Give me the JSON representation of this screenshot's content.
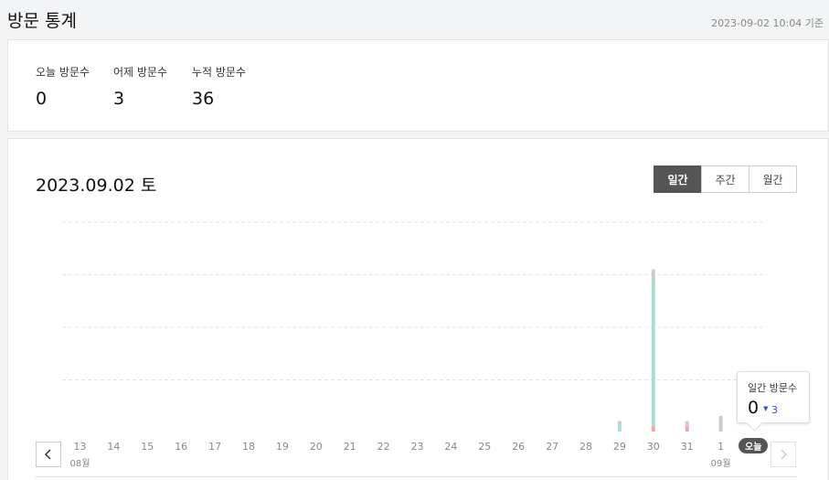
{
  "header": {
    "title": "방문 통계",
    "timestamp": "2023-09-02 10:04 기준"
  },
  "stats": [
    {
      "label": "오늘 방문수",
      "value": "0"
    },
    {
      "label": "어제 방문수",
      "value": "3"
    },
    {
      "label": "누적 방문수",
      "value": "36"
    }
  ],
  "chart_section": {
    "date_title": "2023.09.02 토",
    "period_tabs": [
      {
        "label": "일간",
        "active": true
      },
      {
        "label": "주간",
        "active": false
      },
      {
        "label": "월간",
        "active": false
      }
    ],
    "today_badge": "오늘",
    "prev_icon": "chevron-left-icon",
    "next_icon": "chevron-right-icon"
  },
  "tooltip": {
    "label": "일간 방문수",
    "value": "0",
    "diff": "3",
    "diff_icon": "triangle-down-icon",
    "diff_color": "#2f55c8"
  },
  "chart_data": {
    "type": "bar",
    "categories": [
      "13",
      "14",
      "15",
      "16",
      "17",
      "18",
      "19",
      "20",
      "21",
      "22",
      "23",
      "24",
      "25",
      "26",
      "27",
      "28",
      "29",
      "30",
      "31",
      "1",
      "2"
    ],
    "month_labels": [
      {
        "index": 0,
        "label": "08월"
      },
      {
        "index": 19,
        "label": "09월"
      }
    ],
    "series": [
      {
        "values": [
          0,
          0,
          0,
          0,
          0,
          0,
          0,
          0,
          0,
          0,
          0,
          0,
          0,
          0,
          0,
          0,
          1,
          28,
          0,
          0,
          0
        ],
        "color": "#a8dfd4"
      },
      {
        "values": [
          0,
          0,
          0,
          0,
          0,
          0,
          0,
          0,
          0,
          0,
          0,
          0,
          0,
          0,
          0,
          0,
          0,
          1,
          1,
          0,
          0
        ],
        "color": "#f4a5a5"
      },
      {
        "values": [
          0,
          0,
          0,
          0,
          0,
          0,
          0,
          0,
          0,
          0,
          0,
          0,
          0,
          0,
          0,
          0,
          1,
          2,
          1,
          3,
          0
        ],
        "color": "#cccccc"
      }
    ],
    "ylim": [
      0,
      40
    ],
    "grid": true
  }
}
